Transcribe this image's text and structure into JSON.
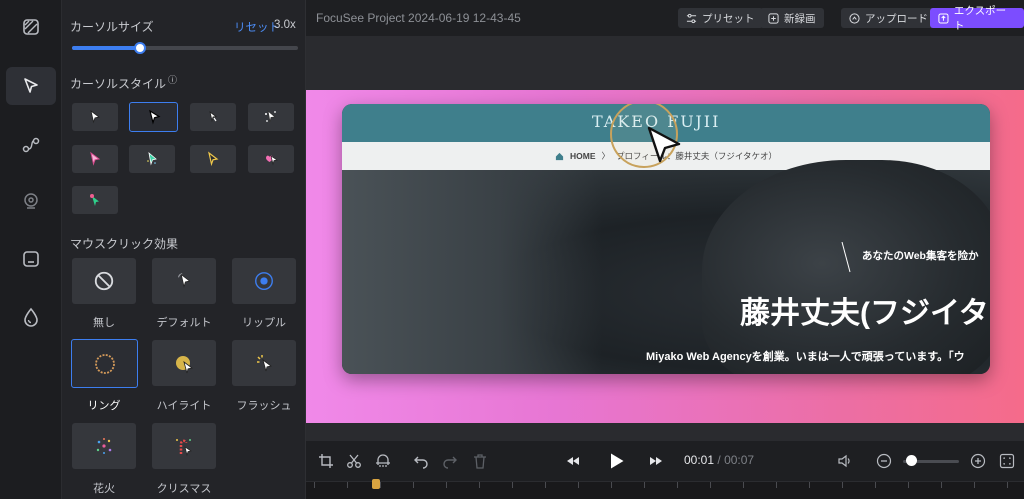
{
  "project_title": "FocuSee Project 2024-06-19 12-43-45",
  "toolbar": {
    "preset_label": "プリセット",
    "new_recording_label": "新録画",
    "upload_label": "アップロード",
    "export_label": "エクスポート"
  },
  "rail": {
    "items": [
      "layout-icon",
      "cursor-icon",
      "path-icon",
      "webcam-icon",
      "caption-icon",
      "drop-icon"
    ],
    "active": "cursor-icon"
  },
  "cursor_size": {
    "label": "カーソルサイズ",
    "reset_label": "リセット",
    "value_label": "3.0x",
    "fraction": 0.3
  },
  "cursor_style": {
    "label": "カーソルスタイル",
    "info_glyph": "ⓘ",
    "styles": [
      "arrow-white",
      "arrow-white-outlined",
      "arrow-small",
      "arrow-sparkle",
      "arrow-pink",
      "arrow-green-glitter",
      "arrow-yellow",
      "arrow-heart",
      "arrow-green-pink"
    ],
    "selected_index": 1
  },
  "click_effect": {
    "label": "マウスクリック効果",
    "items": [
      {
        "label": "無し",
        "icon": "none-icon"
      },
      {
        "label": "デフォルト",
        "icon": "default-click-icon"
      },
      {
        "label": "リップル",
        "icon": "ripple-icon"
      },
      {
        "label": "リング",
        "icon": "ring-icon"
      },
      {
        "label": "ハイライト",
        "icon": "highlight-icon"
      },
      {
        "label": "フラッシュ",
        "icon": "flash-icon"
      },
      {
        "label": "花火",
        "icon": "fireworks-icon"
      },
      {
        "label": "クリスマス",
        "icon": "christmas-icon"
      }
    ],
    "selected_index": 3
  },
  "preview": {
    "logo_text": "TAKEO FUJII",
    "breadcrumb_home": "HOME",
    "breadcrumb_sep": "〉",
    "breadcrumb_page": "プロフィール：藤井丈夫（フジイタケオ）",
    "tagline": "あなたのWeb集客を险か",
    "name": "藤井丈夫(フジイタ",
    "description": "Miyako Web Agencyを創業。いまは一人で頑張っています。「ウ"
  },
  "playback": {
    "current_time": "00:01",
    "separator": "/",
    "total_time": "00:07",
    "zoom_fraction": 0.05
  },
  "colors": {
    "accent": "#3d7ef0",
    "export": "#7c4dff",
    "playhead": "#d9a441"
  }
}
